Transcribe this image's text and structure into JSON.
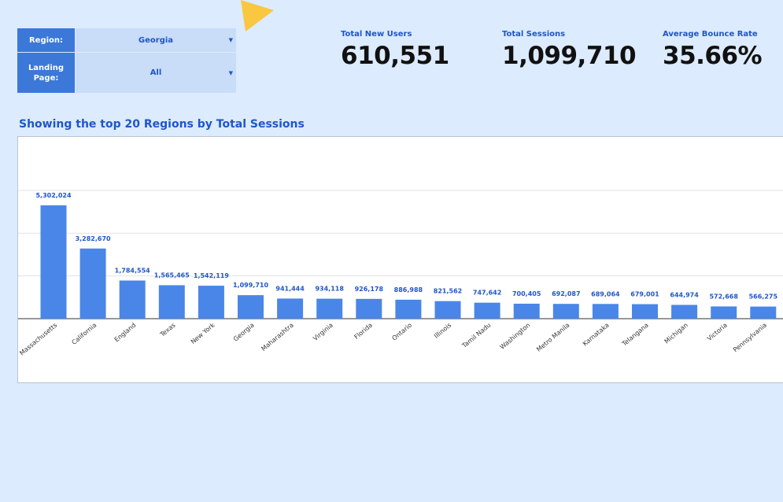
{
  "filters": {
    "region_label": "Region:",
    "region_value": "Georgia",
    "landing_label": "Landing Page:",
    "landing_value": "All"
  },
  "kpis": {
    "new_users_label": "Total New Users",
    "new_users_value": "610,551",
    "sessions_label": "Total Sessions",
    "sessions_value": "1,099,710",
    "bounce_label": "Average Bounce Rate",
    "bounce_value": "35.66%"
  },
  "colors": {
    "bar": "#4a86e8",
    "accent": "#1e56c8",
    "label_bg": "#3b78d8",
    "select_bg": "#c9dcf8",
    "deco": "#f9c740"
  },
  "chart_data": {
    "type": "bar",
    "title": "Showing the top 20 Regions by Total Sessions",
    "categories": [
      "Massachusetts",
      "California",
      "England",
      "Texas",
      "New York",
      "Georgia",
      "Maharashtra",
      "Virginia",
      "Florida",
      "Ontario",
      "Illinois",
      "Tamil Nadu",
      "Washington",
      "Metro Manila",
      "Karnataka",
      "Telangana",
      "Michigan",
      "Victoria",
      "Pennsylvania"
    ],
    "values": [
      5302024,
      3282670,
      1784554,
      1565465,
      1542119,
      1099710,
      941444,
      934118,
      926178,
      886988,
      821562,
      747642,
      700405,
      692087,
      689064,
      679001,
      644974,
      572668,
      566275
    ],
    "value_labels": [
      "5,302,024",
      "3,282,670",
      "1,784,554",
      "1,565,465",
      "1,542,119",
      "1,099,710",
      "941,444",
      "934,118",
      "926,178",
      "886,988",
      "821,562",
      "747,642",
      "700,405",
      "692,087",
      "689,064",
      "679,001",
      "644,974",
      "572,668",
      "566,275"
    ],
    "ylim": [
      0,
      6000000
    ],
    "gridlines": [
      2000000,
      4000000,
      6000000
    ],
    "grid": true,
    "xlabel": "",
    "ylabel": ""
  }
}
